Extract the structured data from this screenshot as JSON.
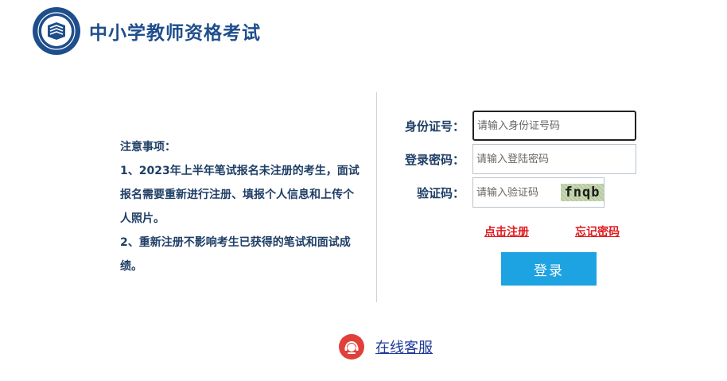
{
  "header": {
    "site_title": "中小学教师资格考试",
    "logo_icon": "teacher-certification-seal"
  },
  "notice": {
    "heading": "注意事项：",
    "item1": "1、2023年上半年笔试报名未注册的考生，面试报名需要重新进行注册、填报个人信息和上传个人照片。",
    "item2": "2、重新注册不影响考生已获得的笔试和面试成绩。"
  },
  "form": {
    "id_label": "身份证号：",
    "id_placeholder": "请输入身份证号码",
    "password_label": "登录密码：",
    "password_placeholder": "请输入登陆密码",
    "captcha_label": "验证码：",
    "captcha_placeholder": "请输入验证码",
    "captcha_text": "fnqb"
  },
  "links": {
    "register": "点击注册",
    "forgot_password": "忘记密码"
  },
  "login_button": "登录",
  "support": {
    "label": "在线客服",
    "icon": "customer-service-icon"
  },
  "colors": {
    "brand": "#1f4e8c",
    "button": "#1da3e2",
    "link_red": "#e0191f",
    "support_icon": "#e0403a"
  }
}
